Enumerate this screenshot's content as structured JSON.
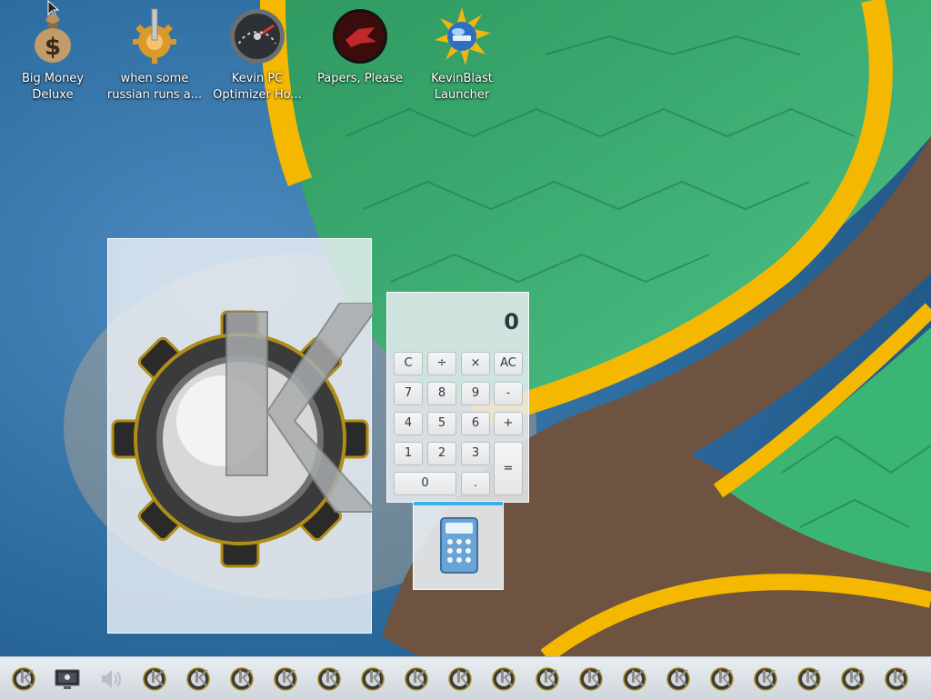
{
  "desktop": {
    "icons": [
      {
        "label": "Big Money\nDeluxe",
        "icon": "money-bag-icon"
      },
      {
        "label": "when some\nrussian runs a...",
        "icon": "gear-icon"
      },
      {
        "label": "Kevin PC\nOptimizer Ho...",
        "icon": "speedometer-icon"
      },
      {
        "label": "Papers, Please",
        "icon": "red-emblem-icon"
      },
      {
        "label": "KevinBlast\nLauncher",
        "icon": "globe-burst-icon"
      }
    ]
  },
  "calculator": {
    "display": "0",
    "buttons": {
      "c": "C",
      "div": "÷",
      "mul": "×",
      "ac": "AC",
      "b7": "7",
      "b8": "8",
      "b9": "9",
      "minus": "-",
      "b4": "4",
      "b5": "5",
      "b6": "6",
      "plus": "+",
      "b1": "1",
      "b2": "2",
      "b3": "3",
      "eq": "=",
      "b0": "0",
      "dot": "."
    }
  },
  "taskbar": {
    "items": [
      "kde-gear-icon",
      "monitor-icon",
      "volume-icon",
      "kde-gear-icon",
      "kde-gear-icon",
      "kde-gear-icon",
      "kde-gear-icon",
      "kde-gear-icon",
      "kde-gear-icon",
      "kde-gear-icon",
      "kde-gear-icon",
      "kde-gear-icon",
      "kde-gear-icon",
      "kde-gear-icon",
      "kde-gear-icon",
      "kde-gear-icon",
      "kde-gear-icon",
      "kde-gear-icon",
      "kde-gear-icon",
      "kde-gear-icon",
      "kde-gear-icon"
    ]
  },
  "colors": {
    "accent": "#3daee9",
    "gold": "#f5b800",
    "green": "#2e9c5e",
    "brown": "#6e5340"
  }
}
